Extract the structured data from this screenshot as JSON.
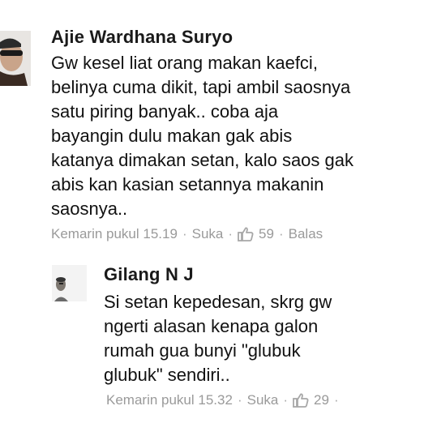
{
  "comment": {
    "author": "Ajie Wardhana Suryo",
    "lines": [
      "Gw kesel liat orang makan kaefci,",
      "belinya cuma dikit, tapi ambil saosnya",
      "satu piring banyak.. coba aja",
      "bayangin dulu makan gak abis",
      "katanya dimakan setan, kalo saos gak",
      "abis kan kasian setannya makanin",
      "saosnya.."
    ],
    "timestamp": "Kemarin pukul 15.19",
    "like_label": "Suka",
    "like_count": "59",
    "reply_label": "Balas",
    "separator": "·",
    "avatar_icon": "profile-photo-icon"
  },
  "reply": {
    "author": "Gilang N J",
    "lines": [
      "Si setan kepedesan, skrg gw",
      "ngerti alasan kenapa galon",
      "rumah gua bunyi \"glubuk",
      "glubuk\" sendiri.."
    ],
    "timestamp": "Kemarin pukul 15.32",
    "like_label": "Suka",
    "like_count": "29",
    "separator": "·",
    "avatar_icon": "profile-photo-icon"
  },
  "colors": {
    "text": "#111111",
    "meta": "#9a9a9a",
    "like_icon": "#a8a8a8"
  }
}
